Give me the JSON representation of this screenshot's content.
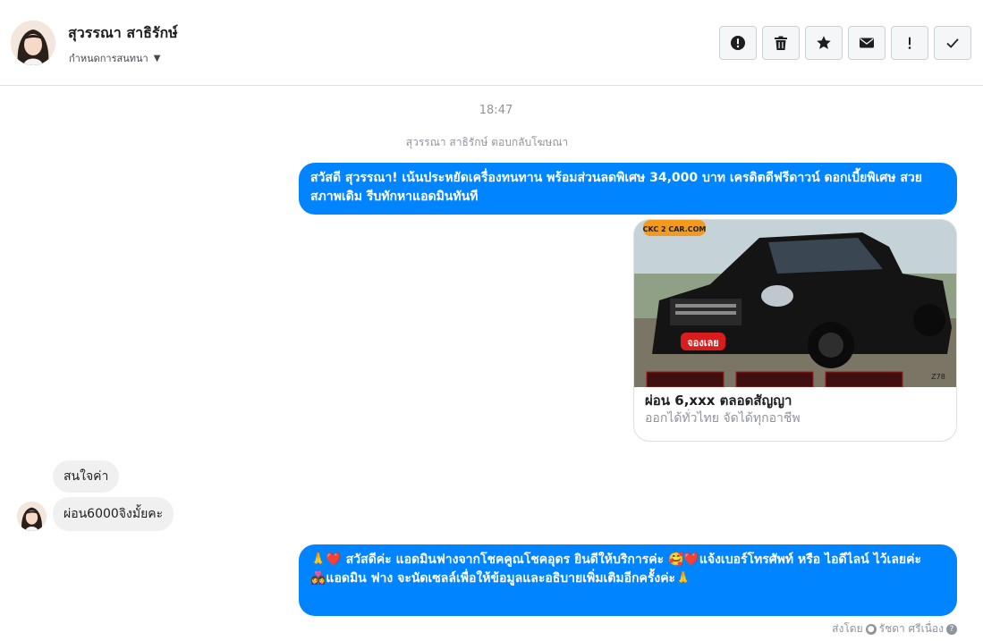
{
  "header": {
    "name": "สุวรรณา สาธิรักษ์",
    "assign_label": "กำหนดการสนทนา",
    "tools": [
      {
        "icon": "alert-icon",
        "name": "report-button"
      },
      {
        "icon": "trash-icon",
        "name": "delete-button"
      },
      {
        "icon": "star-icon",
        "name": "star-button"
      },
      {
        "icon": "envelope-icon",
        "name": "mark-unread-button"
      },
      {
        "icon": "exclamation-icon",
        "name": "spam-button"
      },
      {
        "icon": "check-icon",
        "name": "done-button"
      }
    ]
  },
  "conversation": {
    "time": "18:47",
    "note": "สุวรรณา สาธิรักษ์ ตอบกลับโฆษณา",
    "msg_out_1": "สวัสดี สุวรรณา!  เน้นประหยัดเครื่องทนทาน พร้อมส่วนลดพิเศษ 34,000 บาท เครดิตดีฟรีดาวน์ ดอกเบี้ยพิเศษ สวยสภาพเดิม รีบทักหาแอดมินทันที",
    "ad_card": {
      "logo_text": "CKC 2 CAR.COM",
      "badge_text": "จองเลย",
      "tag_text": "Z78",
      "title": "ผ่อน 6,xxx ตลอดสัญญา",
      "subtitle": "ออกได้ทั่วไทย จัดได้ทุกอาชีพ"
    },
    "msg_in_1": "สนใจค่า",
    "msg_in_2": "ผ่อน6000จิงมั้ยคะ",
    "msg_out_2_line1": "🙏❤️ สวัสดีค่ะ แอดมินฟางจากโชคคูณโชคอุดร ยินดีให้บริการค่ะ  🥰❤️แจ้งเบอร์โทรศัพท์ หรือ ไอดีไลน์  ไว้เลยค่ะ",
    "msg_out_2_line2": "👩‍❤️‍👩แอดมิน ฟาง จะนัดเซลล์เพื่อให้ข้อมูลและอธิบายเพิ่มเติมอีกครั้งค่ะ🙏",
    "sent_by_label": "ส่งโดย",
    "sent_by_name": "รัชดา ศรีเนื่อง"
  },
  "colors": {
    "accent": "#0084ff",
    "incoming_bubble": "#f1f0f0",
    "muted_text": "#90949c"
  }
}
